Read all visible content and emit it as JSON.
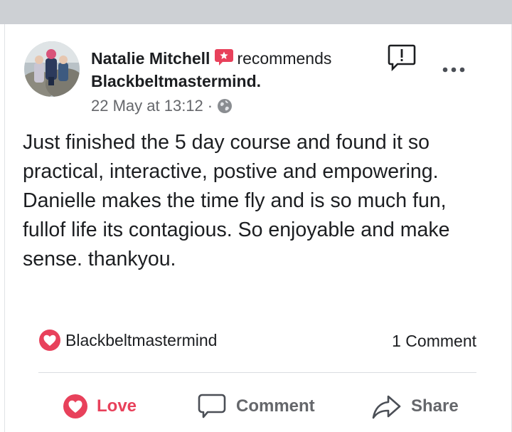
{
  "post": {
    "author": "Natalie Mitchell",
    "verb": "recommends",
    "page": "Blackbeltmastermind.",
    "timestamp": "22 May at 13:12",
    "separator": "·",
    "privacy_icon": "globe-icon",
    "body": "Just finished the 5 day course and found it so practical, interactive, postive and empowering. Danielle makes the time fly and is so much fun, fullof life its contagious. So enjoyable and make sense. thankyou."
  },
  "reactions": {
    "icon": "love-icon",
    "name": "Blackbeltmastermind",
    "comment_count": "1 Comment"
  },
  "actions": {
    "love": "Love",
    "comment": "Comment",
    "share": "Share"
  },
  "colors": {
    "accent_love": "#e8415b",
    "muted": "#65676b",
    "top_bar": "#cdd0d4"
  }
}
